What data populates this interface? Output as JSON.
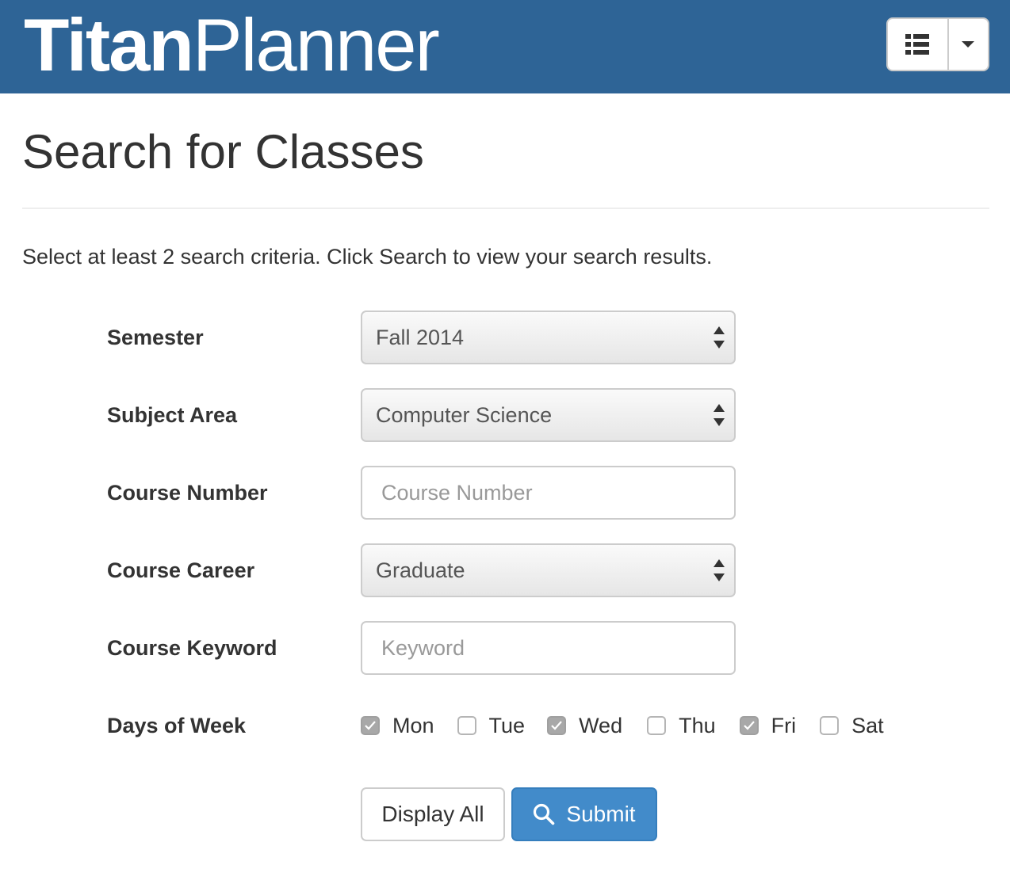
{
  "navbar": {
    "brand_bold": "Titan",
    "brand_light": "Planner",
    "menu_icon": "list-icon",
    "dropdown_icon": "caret-down-icon"
  },
  "page": {
    "title": "Search for Classes",
    "intro": "Select at least 2 search criteria. Click Search to view your search results."
  },
  "form": {
    "semester": {
      "label": "Semester",
      "value": "Fall 2014"
    },
    "subject_area": {
      "label": "Subject Area",
      "value": "Computer Science"
    },
    "course_number": {
      "label": "Course Number",
      "value": "",
      "placeholder": "Course Number"
    },
    "course_career": {
      "label": "Course Career",
      "value": "Graduate"
    },
    "course_keyword": {
      "label": "Course Keyword",
      "value": "",
      "placeholder": "Keyword"
    },
    "days_of_week": {
      "label": "Days of Week",
      "days": [
        {
          "label": "Mon",
          "checked": true
        },
        {
          "label": "Tue",
          "checked": false
        },
        {
          "label": "Wed",
          "checked": true
        },
        {
          "label": "Thu",
          "checked": false
        },
        {
          "label": "Fri",
          "checked": true
        },
        {
          "label": "Sat",
          "checked": false
        }
      ]
    }
  },
  "actions": {
    "display_all": "Display All",
    "submit": "Submit",
    "submit_icon": "search-icon"
  },
  "colors": {
    "navbar": "#2e6496",
    "primary": "#428bca",
    "checked": "#a8a8a8"
  }
}
